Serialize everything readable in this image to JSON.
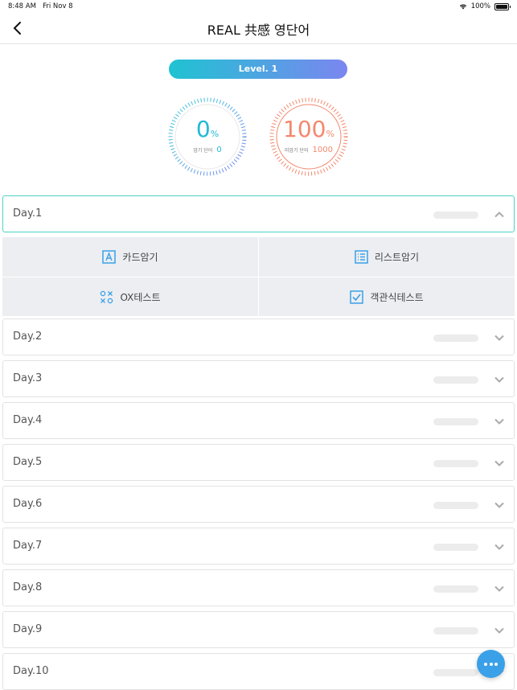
{
  "status_bar": {
    "time": "8:48 AM",
    "date": "Fri Nov 8",
    "battery": "100%"
  },
  "nav": {
    "title": "REAL 共感 영단어",
    "back_icon": "chevron-left-icon"
  },
  "level": {
    "label": "Level. 1"
  },
  "stats": {
    "memorized": {
      "percent": "0",
      "percent_sign": "%",
      "label": "암기 단어",
      "count": "0",
      "color": "#21b9d6"
    },
    "unmemorized": {
      "percent": "100",
      "percent_sign": "%",
      "label": "미암기 단어",
      "count": "1000",
      "color": "#f2896d"
    }
  },
  "days": [
    {
      "label": "Day.1",
      "expanded": true
    },
    {
      "label": "Day.2",
      "expanded": false
    },
    {
      "label": "Day.3",
      "expanded": false
    },
    {
      "label": "Day.4",
      "expanded": false
    },
    {
      "label": "Day.5",
      "expanded": false
    },
    {
      "label": "Day.6",
      "expanded": false
    },
    {
      "label": "Day.7",
      "expanded": false
    },
    {
      "label": "Day.8",
      "expanded": false
    },
    {
      "label": "Day.9",
      "expanded": false
    },
    {
      "label": "Day.10",
      "expanded": false
    }
  ],
  "study_options": {
    "card": {
      "label": "카드암기",
      "icon": "card-a-icon"
    },
    "list": {
      "label": "리스트암기",
      "icon": "list-icon"
    },
    "ox": {
      "label": "OX테스트",
      "icon": "ox-icon"
    },
    "choice": {
      "label": "객관식테스트",
      "icon": "checkbox-icon"
    }
  },
  "fab": {
    "icon": "more-dots-icon"
  },
  "colors": {
    "accent_teal": "#1fc3d2",
    "accent_purple": "#7b86f0",
    "fab_blue": "#3aa0e8"
  }
}
